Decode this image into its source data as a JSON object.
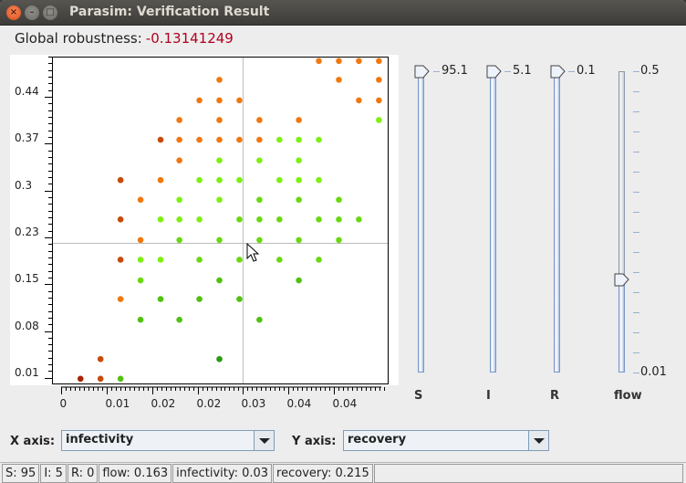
{
  "window": {
    "title": "Parasim: Verification Result",
    "controls": [
      "close",
      "minimize",
      "maximize"
    ]
  },
  "robustness": {
    "label": "Global robustness:",
    "value": "-0.13141249",
    "value_color": "#b00020"
  },
  "chart_data": {
    "type": "scatter",
    "title": "",
    "xlabel": "infectivity",
    "ylabel": "recovery",
    "x_tick_labels": [
      "0",
      "0.01",
      "0.02",
      "0.02",
      "0.03",
      "0.04",
      "0.04"
    ],
    "x_ticks": [
      0,
      0.0075,
      0.015,
      0.0225,
      0.03,
      0.0375,
      0.045
    ],
    "y_tick_labels": [
      "0.01",
      "0.08",
      "0.15",
      "0.23",
      "0.3",
      "0.37",
      "0.44"
    ],
    "y_ticks": [
      0.01,
      0.0814,
      0.1528,
      0.2242,
      0.2956,
      0.367,
      0.4384
    ],
    "xlim": [
      -0.0015,
      0.054
    ],
    "ylim": [
      0.0,
      0.4996
    ],
    "crosshair": {
      "x": 0.03,
      "y": 0.215
    },
    "grid": false,
    "color_legend": {
      "dark_red": "#a82400",
      "dark_orange": "#c84a08",
      "orange": "#f07810",
      "yellow_green": "#7ef010",
      "green": "#6ad810",
      "mid_green": "#52c010",
      "dark_green": "#2a9a10"
    },
    "points": [
      {
        "x": 0.0425,
        "y": 0.4929,
        "c": "orange"
      },
      {
        "x": 0.0458,
        "y": 0.4929,
        "c": "orange"
      },
      {
        "x": 0.0491,
        "y": 0.4929,
        "c": "orange"
      },
      {
        "x": 0.0524,
        "y": 0.4929,
        "c": "orange"
      },
      {
        "x": 0.0261,
        "y": 0.4643,
        "c": "orange"
      },
      {
        "x": 0.0458,
        "y": 0.4643,
        "c": "orange"
      },
      {
        "x": 0.0524,
        "y": 0.4643,
        "c": "orange"
      },
      {
        "x": 0.0228,
        "y": 0.4329,
        "c": "orange"
      },
      {
        "x": 0.0261,
        "y": 0.4329,
        "c": "orange"
      },
      {
        "x": 0.0294,
        "y": 0.4329,
        "c": "orange"
      },
      {
        "x": 0.0491,
        "y": 0.4329,
        "c": "orange"
      },
      {
        "x": 0.0524,
        "y": 0.4329,
        "c": "orange"
      },
      {
        "x": 0.0195,
        "y": 0.4029,
        "c": "orange"
      },
      {
        "x": 0.0261,
        "y": 0.4029,
        "c": "orange"
      },
      {
        "x": 0.0327,
        "y": 0.4029,
        "c": "orange"
      },
      {
        "x": 0.0392,
        "y": 0.4029,
        "c": "orange"
      },
      {
        "x": 0.0524,
        "y": 0.4029,
        "c": "yellow_green"
      },
      {
        "x": 0.0164,
        "y": 0.3729,
        "c": "dark_orange"
      },
      {
        "x": 0.0195,
        "y": 0.3729,
        "c": "orange"
      },
      {
        "x": 0.0228,
        "y": 0.3729,
        "c": "orange"
      },
      {
        "x": 0.0261,
        "y": 0.3729,
        "c": "orange"
      },
      {
        "x": 0.0294,
        "y": 0.3729,
        "c": "orange"
      },
      {
        "x": 0.0327,
        "y": 0.3729,
        "c": "orange"
      },
      {
        "x": 0.036,
        "y": 0.3729,
        "c": "yellow_green"
      },
      {
        "x": 0.0392,
        "y": 0.3729,
        "c": "yellow_green"
      },
      {
        "x": 0.0425,
        "y": 0.3729,
        "c": "yellow_green"
      },
      {
        "x": 0.0195,
        "y": 0.3414,
        "c": "orange"
      },
      {
        "x": 0.0261,
        "y": 0.3414,
        "c": "yellow_green"
      },
      {
        "x": 0.0327,
        "y": 0.3414,
        "c": "yellow_green"
      },
      {
        "x": 0.0392,
        "y": 0.3414,
        "c": "yellow_green"
      },
      {
        "x": 0.0098,
        "y": 0.3114,
        "c": "dark_orange"
      },
      {
        "x": 0.0164,
        "y": 0.3114,
        "c": "orange"
      },
      {
        "x": 0.0228,
        "y": 0.3114,
        "c": "yellow_green"
      },
      {
        "x": 0.0261,
        "y": 0.3114,
        "c": "yellow_green"
      },
      {
        "x": 0.0294,
        "y": 0.3114,
        "c": "yellow_green"
      },
      {
        "x": 0.036,
        "y": 0.3114,
        "c": "yellow_green"
      },
      {
        "x": 0.0392,
        "y": 0.3114,
        "c": "yellow_green"
      },
      {
        "x": 0.0425,
        "y": 0.3114,
        "c": "yellow_green"
      },
      {
        "x": 0.0131,
        "y": 0.2814,
        "c": "orange"
      },
      {
        "x": 0.0195,
        "y": 0.2814,
        "c": "yellow_green"
      },
      {
        "x": 0.0261,
        "y": 0.2814,
        "c": "yellow_green"
      },
      {
        "x": 0.0327,
        "y": 0.2814,
        "c": "green"
      },
      {
        "x": 0.0392,
        "y": 0.2814,
        "c": "green"
      },
      {
        "x": 0.0458,
        "y": 0.2814,
        "c": "green"
      },
      {
        "x": 0.0098,
        "y": 0.2514,
        "c": "dark_orange"
      },
      {
        "x": 0.0164,
        "y": 0.2514,
        "c": "yellow_green"
      },
      {
        "x": 0.0195,
        "y": 0.2514,
        "c": "yellow_green"
      },
      {
        "x": 0.0228,
        "y": 0.2514,
        "c": "yellow_green"
      },
      {
        "x": 0.0294,
        "y": 0.2514,
        "c": "green"
      },
      {
        "x": 0.0327,
        "y": 0.2514,
        "c": "green"
      },
      {
        "x": 0.036,
        "y": 0.2514,
        "c": "green"
      },
      {
        "x": 0.0425,
        "y": 0.2514,
        "c": "green"
      },
      {
        "x": 0.0458,
        "y": 0.2514,
        "c": "green"
      },
      {
        "x": 0.0491,
        "y": 0.2514,
        "c": "green"
      },
      {
        "x": 0.0131,
        "y": 0.22,
        "c": "orange"
      },
      {
        "x": 0.0195,
        "y": 0.22,
        "c": "green"
      },
      {
        "x": 0.0261,
        "y": 0.22,
        "c": "green"
      },
      {
        "x": 0.0327,
        "y": 0.22,
        "c": "green"
      },
      {
        "x": 0.0392,
        "y": 0.22,
        "c": "green"
      },
      {
        "x": 0.0458,
        "y": 0.22,
        "c": "green"
      },
      {
        "x": 0.0098,
        "y": 0.19,
        "c": "dark_orange"
      },
      {
        "x": 0.0131,
        "y": 0.19,
        "c": "yellow_green"
      },
      {
        "x": 0.0164,
        "y": 0.19,
        "c": "yellow_green"
      },
      {
        "x": 0.0228,
        "y": 0.19,
        "c": "green"
      },
      {
        "x": 0.0294,
        "y": 0.19,
        "c": "green"
      },
      {
        "x": 0.036,
        "y": 0.19,
        "c": "green"
      },
      {
        "x": 0.0425,
        "y": 0.19,
        "c": "green"
      },
      {
        "x": 0.0131,
        "y": 0.1586,
        "c": "green"
      },
      {
        "x": 0.0261,
        "y": 0.1586,
        "c": "mid_green"
      },
      {
        "x": 0.0392,
        "y": 0.1586,
        "c": "mid_green"
      },
      {
        "x": 0.0098,
        "y": 0.13,
        "c": "orange"
      },
      {
        "x": 0.0164,
        "y": 0.13,
        "c": "mid_green"
      },
      {
        "x": 0.0228,
        "y": 0.13,
        "c": "mid_green"
      },
      {
        "x": 0.0294,
        "y": 0.13,
        "c": "mid_green"
      },
      {
        "x": 0.0131,
        "y": 0.0986,
        "c": "mid_green"
      },
      {
        "x": 0.0195,
        "y": 0.0986,
        "c": "mid_green"
      },
      {
        "x": 0.0327,
        "y": 0.0986,
        "c": "mid_green"
      },
      {
        "x": 0.0065,
        "y": 0.0386,
        "c": "dark_orange"
      },
      {
        "x": 0.0261,
        "y": 0.0386,
        "c": "dark_green"
      },
      {
        "x": 0.0032,
        "y": 0.0086,
        "c": "dark_red"
      },
      {
        "x": 0.0065,
        "y": 0.0086,
        "c": "dark_orange"
      },
      {
        "x": 0.0098,
        "y": 0.0086,
        "c": "mid_green"
      }
    ]
  },
  "sliders": [
    {
      "name": "S",
      "label": "S",
      "value_label": "95.1",
      "position": 1.0
    },
    {
      "name": "I",
      "label": "I",
      "value_label": "5.1",
      "position": 1.0
    },
    {
      "name": "R",
      "label": "R",
      "value_label": "0.1",
      "position": 1.0
    },
    {
      "name": "flow",
      "label": "flow",
      "max_label": "0.5",
      "min_label": "0.01",
      "position": 0.31
    }
  ],
  "axis_selectors": {
    "x": {
      "label": "X axis:",
      "value": "infectivity"
    },
    "y": {
      "label": "Y axis:",
      "value": "recovery"
    }
  },
  "statusbar": {
    "cells": [
      "S: 95",
      "I: 5",
      "R: 0",
      "flow: 0.163",
      "infectivity: 0.03",
      "recovery: 0.215",
      ""
    ]
  }
}
